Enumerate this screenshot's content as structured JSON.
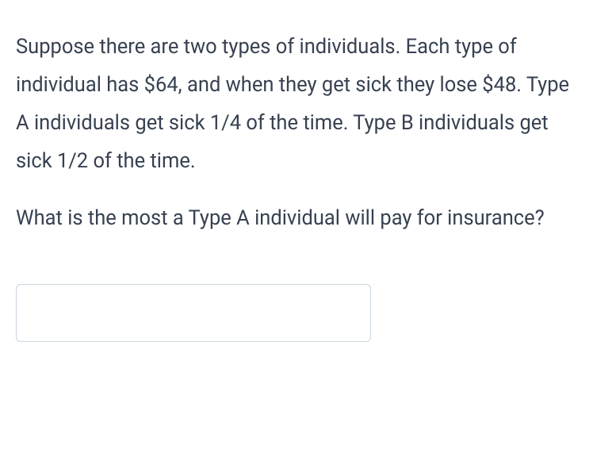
{
  "question": {
    "context": "Suppose there are two types of individuals.  Each type of individual has $64, and when they get sick they lose $48.  Type A individuals get sick 1/4 of the time.  Type B individuals get sick 1/2 of the time.",
    "prompt": "What is the most a Type A individual will pay for insurance?",
    "answer_value": ""
  }
}
